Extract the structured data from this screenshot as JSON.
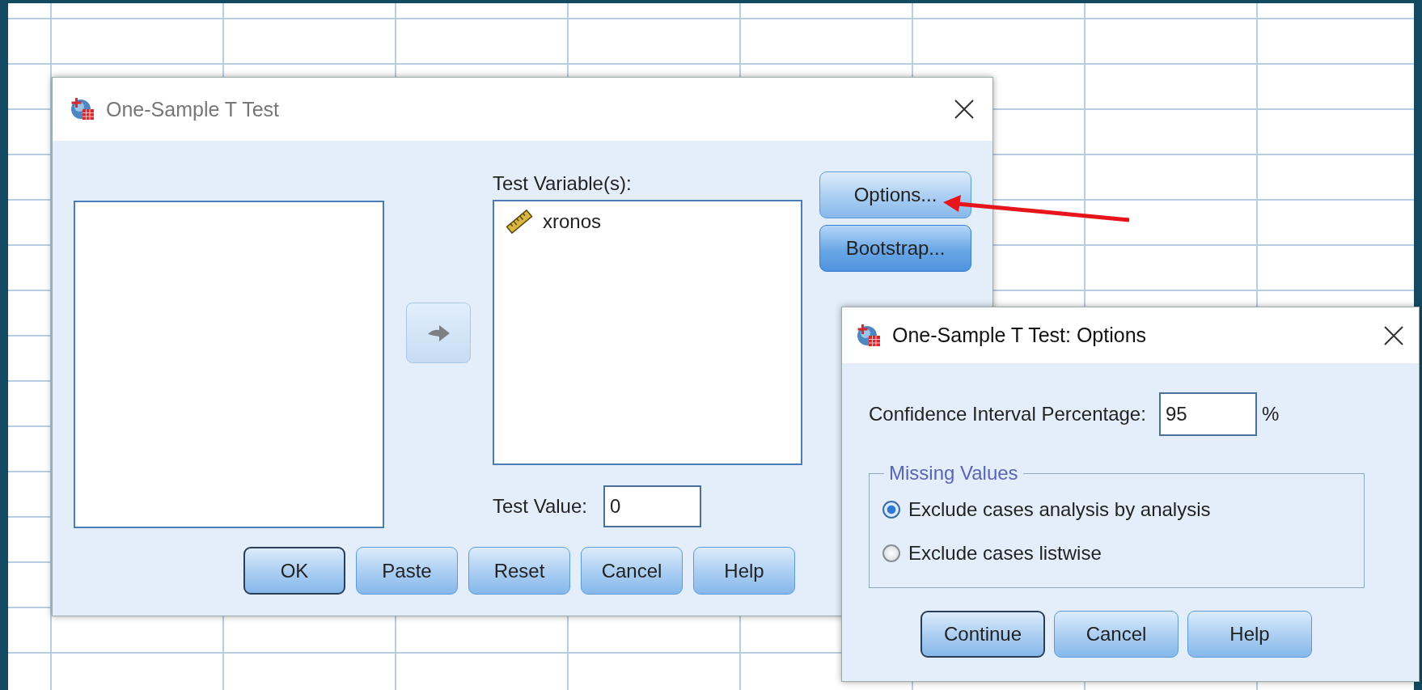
{
  "main_dialog": {
    "title": "One-Sample T Test",
    "test_variables_label": "Test Variable(s):",
    "test_variables": [
      {
        "name": "xronos"
      }
    ],
    "side_buttons": [
      {
        "label": "Options...",
        "highlighted": false
      },
      {
        "label": "Bootstrap...",
        "highlighted": true
      }
    ],
    "test_value_label": "Test Value:",
    "test_value": "0",
    "buttons": [
      {
        "label": "OK",
        "default": true
      },
      {
        "label": "Paste",
        "default": false
      },
      {
        "label": "Reset",
        "default": false
      },
      {
        "label": "Cancel",
        "default": false
      },
      {
        "label": "Help",
        "default": false
      }
    ]
  },
  "options_dialog": {
    "title": "One-Sample T Test: Options",
    "confidence_label": "Confidence Interval Percentage:",
    "confidence_value": "95",
    "confidence_unit": "%",
    "missing_values": {
      "title": "Missing Values",
      "options": [
        {
          "label": "Exclude cases analysis by analysis",
          "selected": true
        },
        {
          "label": "Exclude cases listwise",
          "selected": false
        }
      ]
    },
    "buttons": [
      {
        "label": "Continue",
        "default": true
      },
      {
        "label": "Cancel",
        "default": false
      },
      {
        "label": "Help",
        "default": false
      }
    ]
  }
}
